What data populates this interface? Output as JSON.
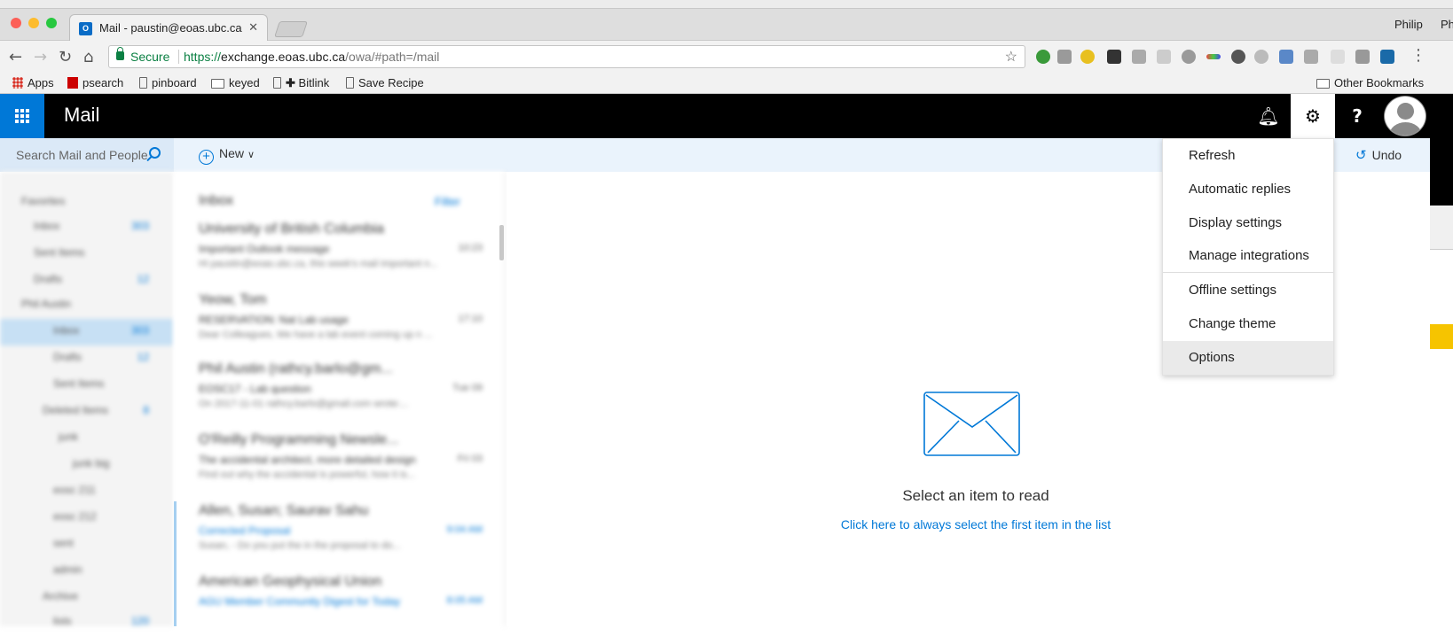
{
  "window": {
    "profile_name": "Philip",
    "profile_name_clipped": "Ph"
  },
  "tab": {
    "title": "Mail - paustin@eoas.ubc.ca",
    "favicon": "outlook-icon"
  },
  "address_bar": {
    "secure_label": "Secure",
    "url_scheme": "https://",
    "url_host": "exchange.eoas.ubc.ca",
    "url_path": "/owa/#path=/mail"
  },
  "bookmarks": {
    "items": [
      "Apps",
      "psearch",
      "pinboard",
      "keyed",
      "Bitlink",
      "Save Recipe"
    ],
    "other": "Other Bookmarks"
  },
  "owa": {
    "app_name": "Mail",
    "search_placeholder": "Search Mail and People",
    "new_label": "New",
    "undo_label": "Undo"
  },
  "settings_menu": {
    "items": [
      "Refresh",
      "Automatic replies",
      "Display settings",
      "Manage integrations",
      "Offline settings",
      "Change theme",
      "Options"
    ],
    "highlighted": "Options"
  },
  "folder_pane": {
    "items": [
      {
        "label": "Favorites",
        "count": ""
      },
      {
        "label": "Inbox",
        "count": "303"
      },
      {
        "label": "Sent Items",
        "count": ""
      },
      {
        "label": "Drafts",
        "count": "12"
      },
      {
        "label": "Phil Austin",
        "count": ""
      },
      {
        "label": "Inbox",
        "count": "303"
      },
      {
        "label": "Drafts",
        "count": "12"
      },
      {
        "label": "Sent Items",
        "count": ""
      },
      {
        "label": "Deleted Items",
        "count": "8"
      },
      {
        "label": "junk",
        "count": ""
      },
      {
        "label": "junk big",
        "count": ""
      },
      {
        "label": "eosc 211",
        "count": ""
      },
      {
        "label": "eosc 212",
        "count": ""
      },
      {
        "label": "sent",
        "count": ""
      },
      {
        "label": "admin",
        "count": ""
      },
      {
        "label": "Archive",
        "count": ""
      },
      {
        "label": "lists",
        "count": "120"
      }
    ]
  },
  "message_list": {
    "header": "Inbox",
    "filter_label": "Filter",
    "messages": [
      {
        "from": "University of British Columbia",
        "subject": "Important Outlook message",
        "time": "10:23",
        "preview": "Hi paustin@eoas.ubc.ca, this week's mail important n...",
        "unread": false
      },
      {
        "from": "Yeow, Tom",
        "subject": "RESERVATION: Nat Lab usage",
        "time": "17:10",
        "preview": "Dear Colleagues, We have a lab event coming up n ...",
        "unread": false
      },
      {
        "from": "Phil Austin (rathcy.barlo@gm...",
        "subject": "EOSC17 - Lab question",
        "time": "Tue 09",
        "preview": "On 2017-11-01 rathcy.barlo@gmail.com wrote:...",
        "unread": false
      },
      {
        "from": "O'Reilly Programming Newsle...",
        "subject": "The accidental architect, more detailed design",
        "time": "Fri 03",
        "preview": "Find out why the accidental is powerful, how it is...",
        "unread": false
      },
      {
        "from": "Allen, Susan; Saurav Sahu",
        "subject": "Corrected Proposal",
        "time": "9:04 AM",
        "preview": "Susan, - Do you put the in the proposal to do...",
        "unread": true
      },
      {
        "from": "American Geophysical Union",
        "subject": "AGU Member Community Digest for Today",
        "time": "8:05 AM",
        "preview": "",
        "unread": true
      }
    ]
  },
  "reading_pane": {
    "empty_title": "Select an item to read",
    "empty_link": "Click here to always select the first item in the list"
  },
  "colors": {
    "accent": "#0078d7",
    "header_bg": "#000000",
    "command_bar_bg": "#eaf3fc",
    "secure_green": "#0b8043"
  }
}
